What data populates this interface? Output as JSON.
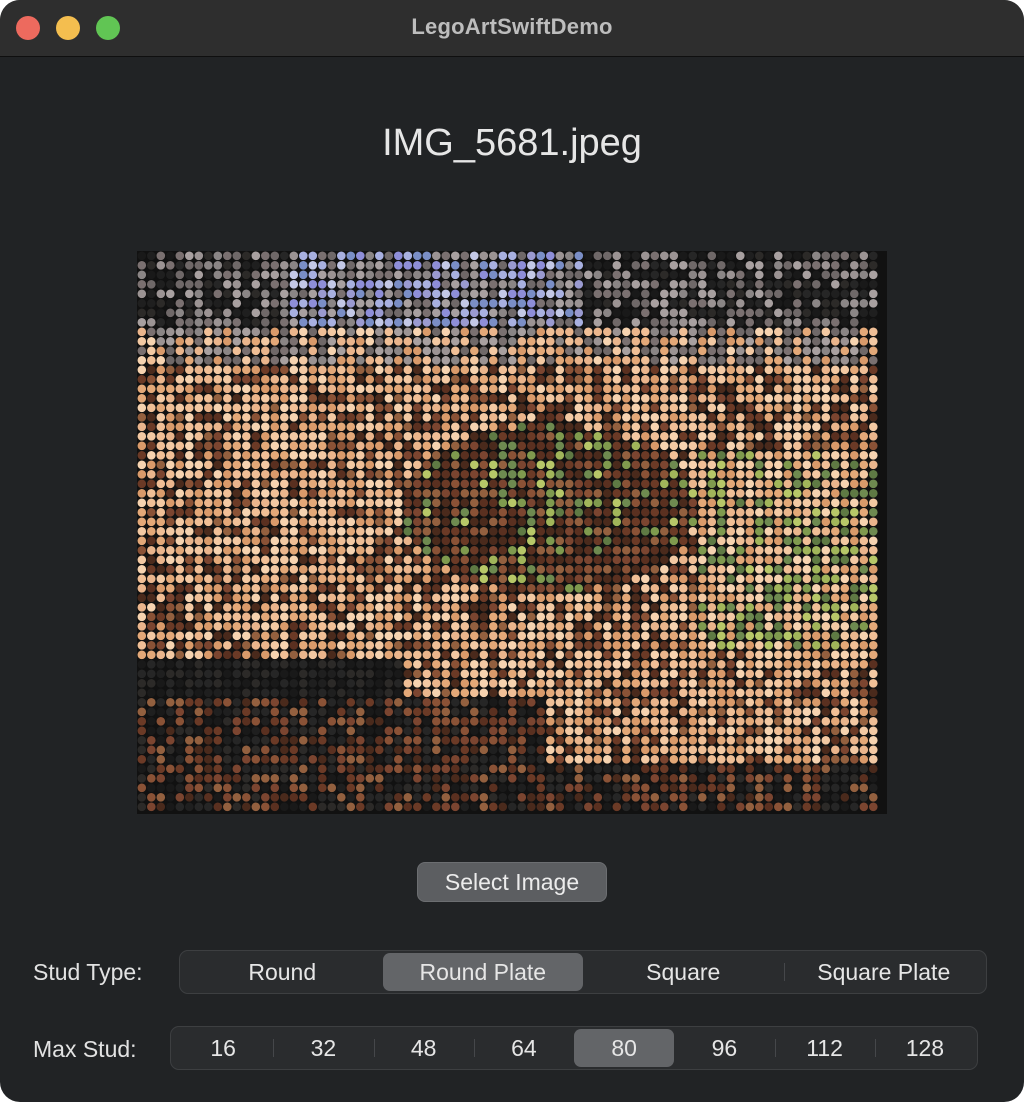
{
  "window": {
    "title": "LegoArtSwiftDemo"
  },
  "image": {
    "file_name": "IMG_5681.jpeg"
  },
  "select_button": {
    "label": "Select Image"
  },
  "stud_type": {
    "label": "Stud Type:",
    "options": [
      "Round",
      "Round Plate",
      "Square",
      "Square Plate"
    ],
    "selected": "Round Plate"
  },
  "max_stud": {
    "label": "Max Stud:",
    "options": [
      "16",
      "32",
      "48",
      "64",
      "80",
      "96",
      "112",
      "128"
    ],
    "selected": "80"
  },
  "colors": {
    "window_bg": "#212325",
    "titlebar_bg": "#2e2e2e",
    "selected_segment": "#636568",
    "close": "#ed6a5e",
    "minimize": "#f4be4f",
    "maximize": "#61c554"
  }
}
